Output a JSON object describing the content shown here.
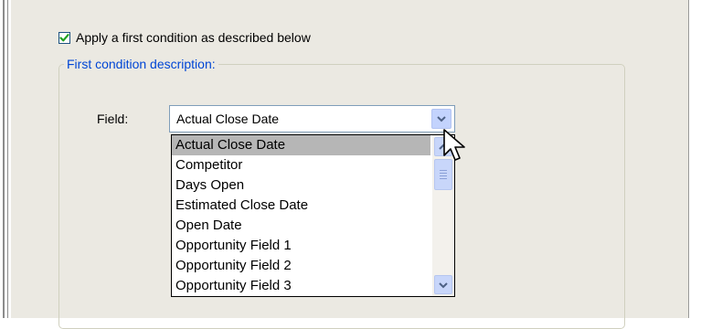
{
  "condition": {
    "checkbox_checked": true,
    "checkbox_label": "Apply a first condition as described below",
    "group_title": "First condition description:"
  },
  "field": {
    "label": "Field:",
    "selected_value": "Actual Close Date",
    "options": [
      "Actual Close Date",
      "Competitor",
      "Days Open",
      "Estimated Close Date",
      "Open Date",
      "Opportunity Field 1",
      "Opportunity Field 2",
      "Opportunity Field 3"
    ],
    "highlighted_index": 0
  },
  "colors": {
    "panel_bg": "#ebe9e2",
    "group_title": "#0046d5",
    "selection_bg": "#b6b6b6",
    "check_mark": "#21a121"
  },
  "icons": {
    "checkbox": "check-icon",
    "combo_dropdown": "chevron-down-icon",
    "scroll_up": "chevron-up-icon",
    "scroll_down": "chevron-down-icon",
    "pointer": "mouse-cursor-icon"
  }
}
